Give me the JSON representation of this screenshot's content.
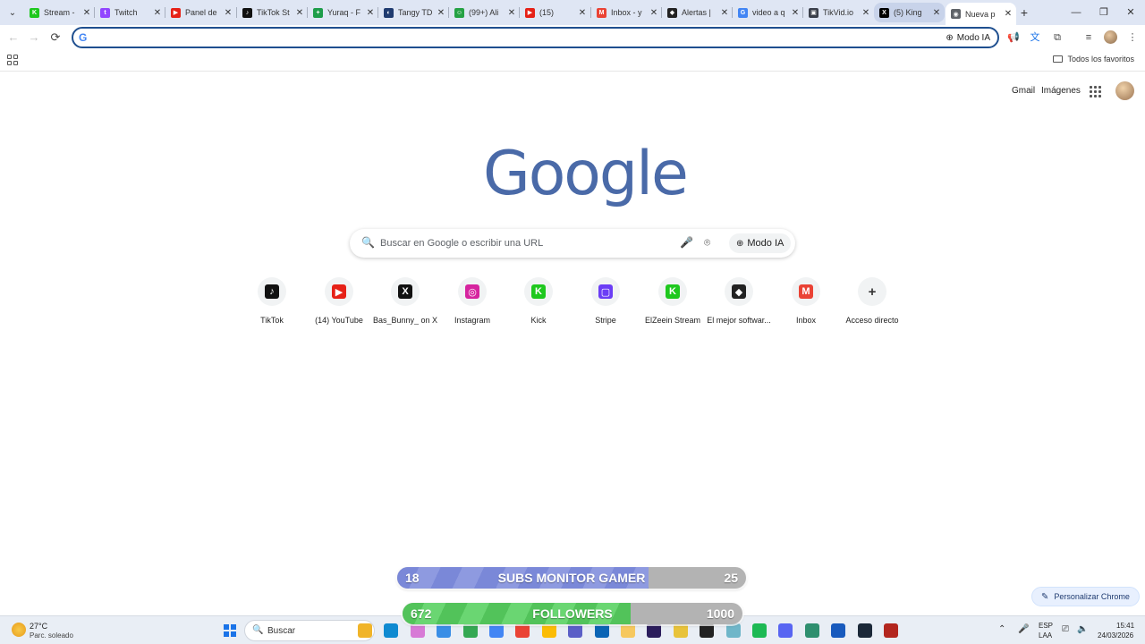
{
  "window": {
    "tabs": [
      {
        "title": "Stream -",
        "fav_color": "#1ec81e",
        "fav_glyph": "K"
      },
      {
        "title": "Twitch",
        "fav_color": "#9146ff",
        "fav_glyph": "t"
      },
      {
        "title": "Panel de",
        "fav_color": "#e62117",
        "fav_glyph": "▶"
      },
      {
        "title": "TikTok St",
        "fav_color": "#111111",
        "fav_glyph": "♪"
      },
      {
        "title": "Yuraq - F",
        "fav_color": "#1e9d4a",
        "fav_glyph": "+"
      },
      {
        "title": "Tangy TD",
        "fav_color": "#1f3b70",
        "fav_glyph": "◐"
      },
      {
        "title": "(99+) Ali",
        "fav_color": "#25a244",
        "fav_glyph": "☺"
      },
      {
        "title": "(15)",
        "fav_color": "#e62117",
        "fav_glyph": "▶"
      },
      {
        "title": "Inbox - y",
        "fav_color": "#ea4335",
        "fav_glyph": "M"
      },
      {
        "title": "Alertas |",
        "fav_color": "#222222",
        "fav_glyph": "◆"
      },
      {
        "title": "video a q",
        "fav_color": "#4285f4",
        "fav_glyph": "G"
      },
      {
        "title": "TikVid.io",
        "fav_color": "#3a3f4a",
        "fav_glyph": "▣"
      },
      {
        "title": "(5) King",
        "fav_color": "#000000",
        "fav_glyph": "X"
      },
      {
        "title": "Nueva p",
        "fav_color": "#5f6368",
        "fav_glyph": "◉"
      }
    ],
    "new_tab_symbol": "+",
    "controls": {
      "minimize": "—",
      "maximize": "❐",
      "close": "✕"
    }
  },
  "toolbar": {
    "back": "←",
    "forward": "→",
    "reload": "⟳",
    "omnibox_logo": "G",
    "omnibox_value": "",
    "ai_mode_label": "Modo IA",
    "ai_icon": "⊕",
    "ext_icons": {
      "alert": "📢",
      "translate": "文",
      "extensions": "⧉",
      "media": "≡",
      "menu": "⋮"
    }
  },
  "bookmarks": {
    "all_bookmarks_label": "Todos los favoritos"
  },
  "ntp": {
    "gmail_label": "Gmail",
    "images_label": "Imágenes",
    "logo_text": "Google",
    "search_placeholder": "Buscar en Google o escribir una URL",
    "search_icon": "🔍",
    "mic_icon": "🎤",
    "lens_icon": "⌾",
    "ai_mode_label": "Modo IA",
    "ai_icon": "⊕",
    "shortcuts": [
      {
        "label": "TikTok",
        "color": "#111111",
        "glyph": "♪"
      },
      {
        "label": "(14) YouTube",
        "color": "#e62117",
        "glyph": "▶"
      },
      {
        "label": "Bas_Bunny_ on X",
        "color": "#111111",
        "glyph": "X"
      },
      {
        "label": "Instagram",
        "color": "#d6249f",
        "glyph": "◎"
      },
      {
        "label": "Kick",
        "color": "#1ec81e",
        "glyph": "K"
      },
      {
        "label": "Stripe",
        "color": "#6b3df5",
        "glyph": "▢"
      },
      {
        "label": "ElZeein Stream",
        "color": "#1ec81e",
        "glyph": "K"
      },
      {
        "label": "El mejor softwar...",
        "color": "#222222",
        "glyph": "◆"
      },
      {
        "label": "Inbox",
        "color": "#ea4335",
        "glyph": "M"
      },
      {
        "label": "Acceso directo",
        "color": "#333333",
        "glyph": "+"
      }
    ],
    "customize_label": "Personalizar Chrome",
    "customize_icon": "✎"
  },
  "overlays": {
    "subs": {
      "current": "18",
      "title": "SUBS MONITOR GAMER",
      "goal": "25",
      "progress": 0.72
    },
    "followers": {
      "current": "672",
      "title": "FOLLOWERS",
      "goal": "1000",
      "progress": 0.672
    }
  },
  "taskbar": {
    "weather_temp": "27°C",
    "weather_desc": "Parc. soleado",
    "search_label": "Buscar",
    "search_icon": "🔍",
    "apps": [
      {
        "name": "file-explorer",
        "color": "#f0b429"
      },
      {
        "name": "edge",
        "color": "#0f8ad1"
      },
      {
        "name": "copilot",
        "color": "#d77ad6"
      },
      {
        "name": "store",
        "color": "#3a8ee6"
      },
      {
        "name": "chrome-1",
        "color": "#34a853"
      },
      {
        "name": "chrome-2",
        "color": "#4285f4"
      },
      {
        "name": "chrome-3",
        "color": "#ea4335"
      },
      {
        "name": "chrome-4",
        "color": "#fbbc05"
      },
      {
        "name": "app-blue",
        "color": "#5b5fc7"
      },
      {
        "name": "outlook",
        "color": "#0a64b5"
      },
      {
        "name": "files",
        "color": "#f6c85f"
      },
      {
        "name": "premiere",
        "color": "#2b1d5c"
      },
      {
        "name": "app-yellow",
        "color": "#e8c33a"
      },
      {
        "name": "app-dark",
        "color": "#222222"
      },
      {
        "name": "app-teal",
        "color": "#6fb6c9"
      },
      {
        "name": "spotify",
        "color": "#1db954"
      },
      {
        "name": "discord",
        "color": "#5865f2"
      },
      {
        "name": "notes",
        "color": "#2f8f6f"
      },
      {
        "name": "word",
        "color": "#185abd"
      },
      {
        "name": "steam",
        "color": "#1b2838"
      },
      {
        "name": "app-red",
        "color": "#b3261e"
      }
    ],
    "language": "ESP",
    "layout": "LAA",
    "time": "15:41",
    "date": "24/03/2026"
  }
}
